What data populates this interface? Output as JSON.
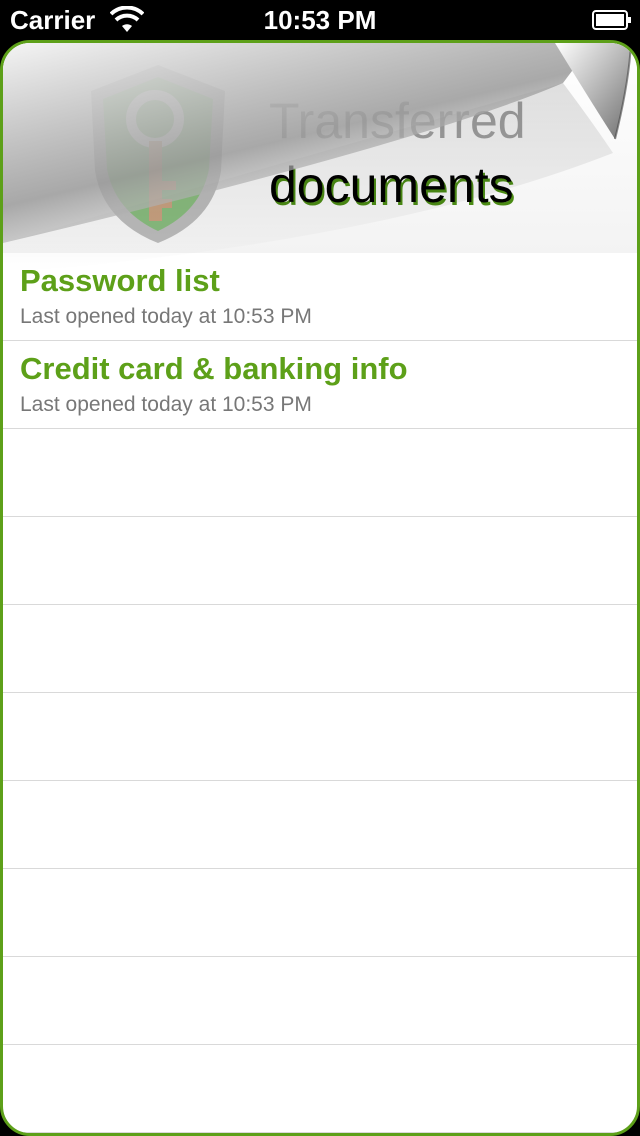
{
  "status_bar": {
    "carrier": "Carrier",
    "time": "10:53 PM"
  },
  "header": {
    "title_line1": "Transferred",
    "title_line2": "documents",
    "logo_icon": "shield-key-icon"
  },
  "documents": [
    {
      "name": "Password list",
      "subtitle": "Last opened today at 10:53 PM"
    },
    {
      "name": "Credit card & banking info",
      "subtitle": "Last opened today at 10:53 PM"
    }
  ],
  "empty_rows": 8,
  "colors": {
    "accent": "#5da019",
    "subtitle": "#777777",
    "separator": "#d9d9d9"
  }
}
